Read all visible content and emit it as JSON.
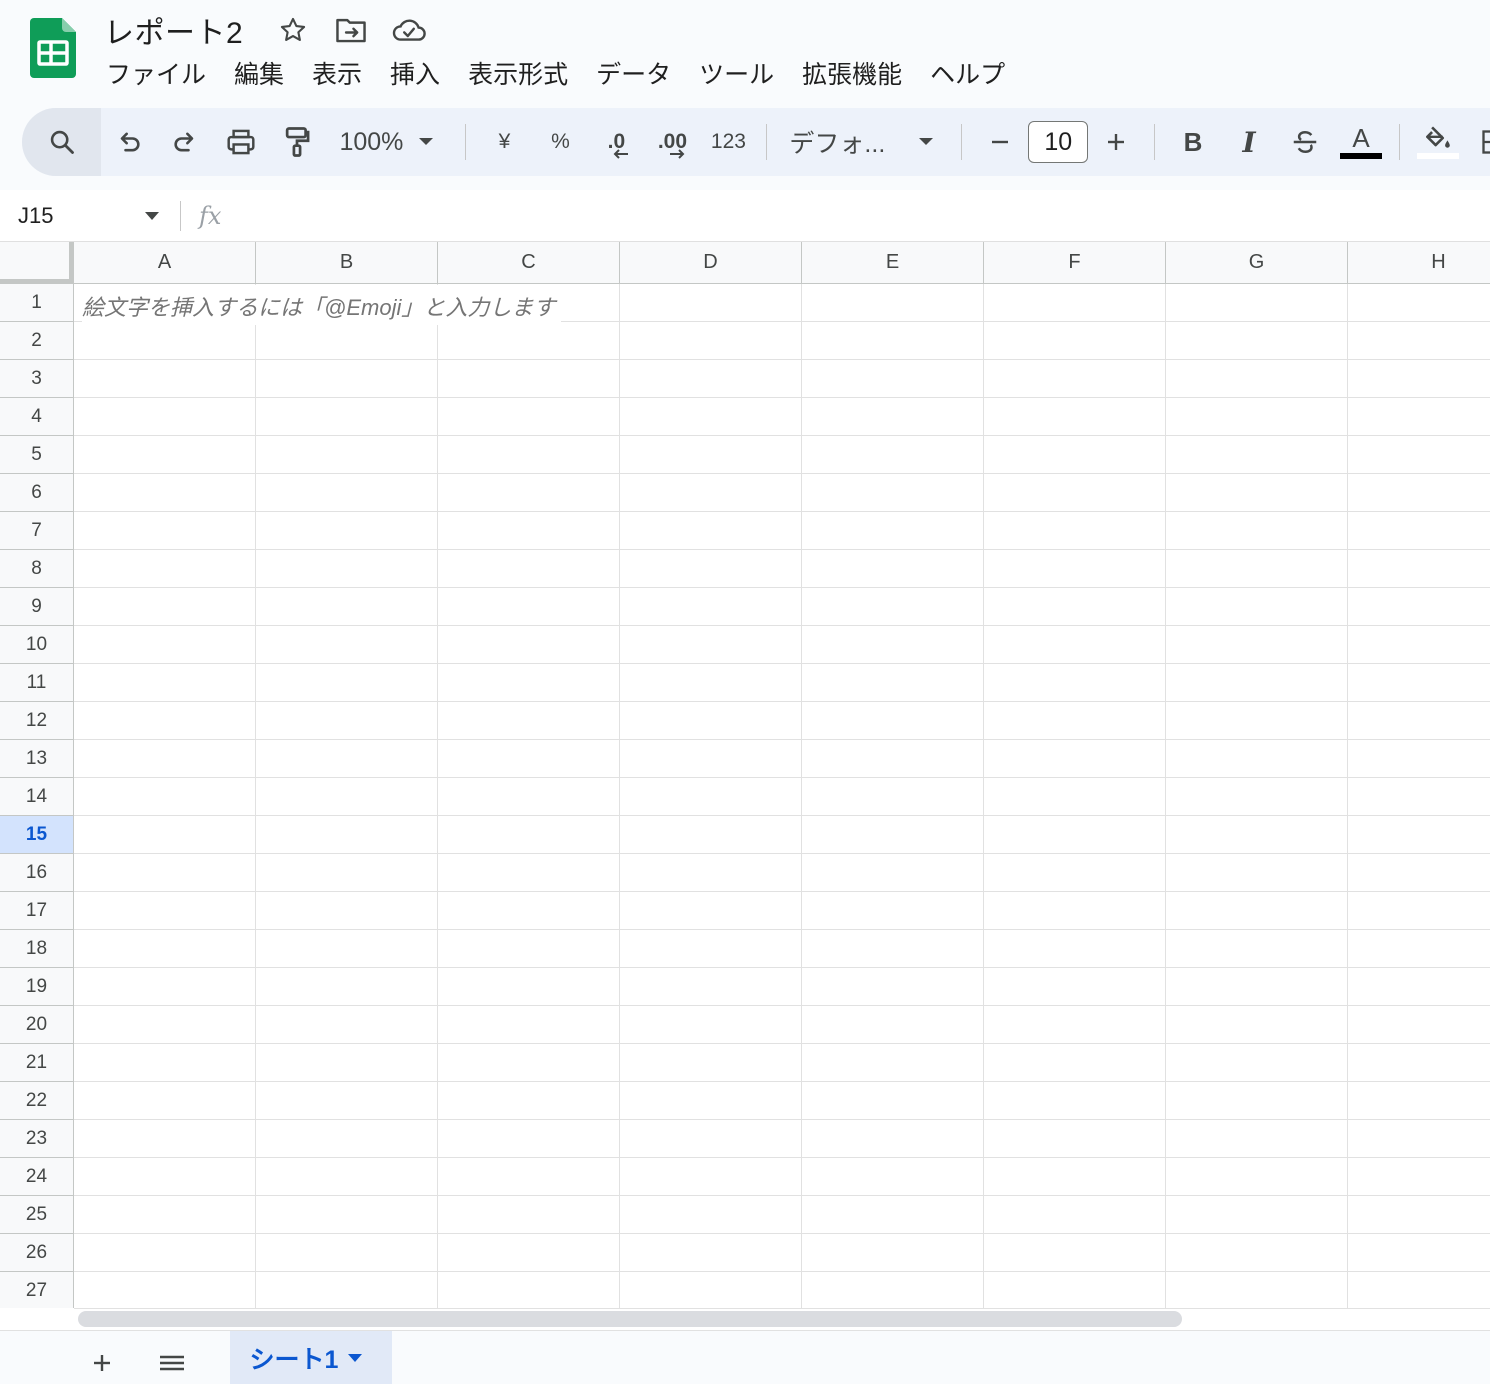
{
  "app": {
    "doc_title": "レポート2",
    "icons": [
      "sheets-logo-icon",
      "star-icon",
      "move-folder-icon",
      "cloud-saved-icon"
    ]
  },
  "menu": [
    "ファイル",
    "編集",
    "表示",
    "挿入",
    "表示形式",
    "データ",
    "ツール",
    "拡張機能",
    "ヘルプ"
  ],
  "toolbar": {
    "zoom": "100%",
    "currency": "¥",
    "percent": "%",
    "decrease_decimal": ".0",
    "increase_decimal": ".00",
    "number_format": "123",
    "font": "デフォ...",
    "font_size": "10",
    "minus": "−",
    "plus": "+",
    "bold": "B",
    "italic": "I",
    "text_color_label": "A"
  },
  "formula_bar": {
    "name_box": "J15",
    "fx": "fx",
    "value": ""
  },
  "grid": {
    "columns": [
      "A",
      "B",
      "C",
      "D",
      "E",
      "F",
      "G",
      "H"
    ],
    "rows": [
      "1",
      "2",
      "3",
      "4",
      "5",
      "6",
      "7",
      "8",
      "9",
      "10",
      "11",
      "12",
      "13",
      "14",
      "15",
      "16",
      "17",
      "18",
      "19",
      "20",
      "21",
      "22",
      "23",
      "24",
      "25",
      "26",
      "27"
    ],
    "active_row": "15",
    "a1_placeholder": "絵文字を挿入するには「@Emoji」と入力します"
  },
  "sheets": {
    "tabs": [
      {
        "label": "シート1",
        "active": true
      }
    ]
  },
  "colors": {
    "accent": "#0b57d0",
    "sheets_green": "#0f9d58",
    "toolbar_bg": "#edf2fa"
  }
}
